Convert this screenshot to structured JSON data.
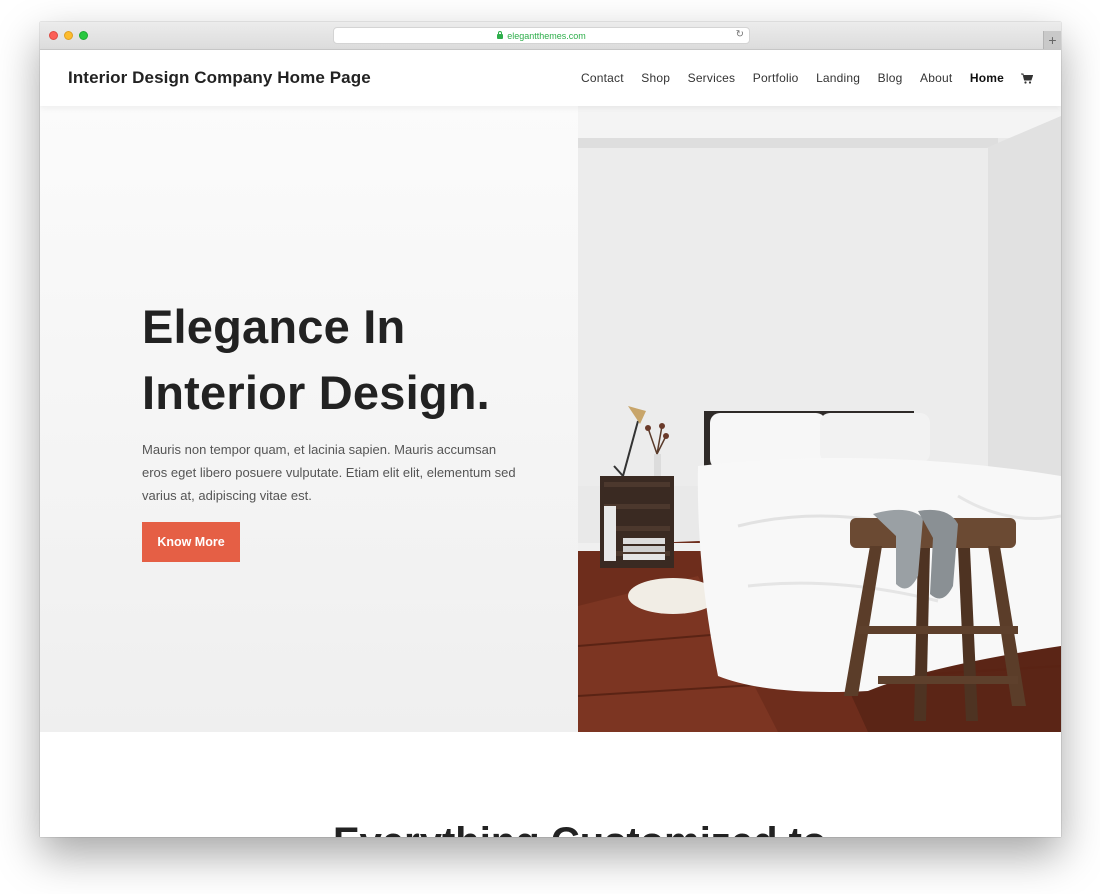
{
  "browser": {
    "url": "elegantthemes.com",
    "new_tab_icon": "plus-icon",
    "reload_icon": "reload-icon"
  },
  "site": {
    "title": "Interior Design Company Home Page",
    "nav": [
      {
        "label": "Contact"
      },
      {
        "label": "Shop"
      },
      {
        "label": "Services"
      },
      {
        "label": "Portfolio"
      },
      {
        "label": "Landing"
      },
      {
        "label": "Blog"
      },
      {
        "label": "About"
      },
      {
        "label": "Home",
        "active": true
      }
    ],
    "cart_icon": "cart-icon"
  },
  "hero": {
    "heading_line1": "Elegance In",
    "heading_line2": "Interior Design.",
    "text": "Mauris non tempor quam, et lacinia sapien. Mauris accumsan eros eget libero posuere vulputate. Etiam elit elit, elementum sed varius at, adipiscing vitae est.",
    "button_label": "Know More",
    "image_alt": "bedroom-photo"
  },
  "section": {
    "heading": "Everything Customized to..."
  },
  "colors": {
    "accent": "#e55f45",
    "heading": "#222222",
    "body_text": "#555555",
    "url_green": "#2eae4b"
  }
}
